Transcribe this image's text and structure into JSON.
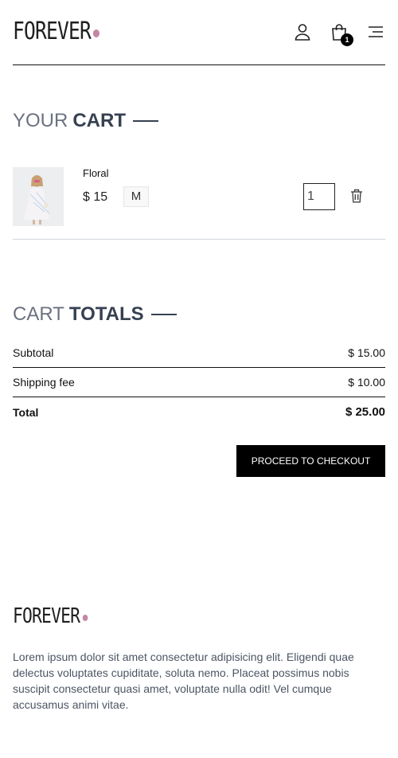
{
  "brand": {
    "logo_text": "FOREVER",
    "accent_color": "#c586a5"
  },
  "header": {
    "cart_count": "1",
    "icons": [
      "user-icon",
      "shopping-bag-icon",
      "menu-icon"
    ]
  },
  "cart": {
    "title_light": "YOUR",
    "title_bold": "CART",
    "items": [
      {
        "name": "Floral",
        "price": "$ 15",
        "size": "M",
        "quantity": "1"
      }
    ]
  },
  "totals": {
    "title_light": "CART",
    "title_bold": "TOTALS",
    "subtotal_label": "Subtotal",
    "subtotal_value": "$ 15.00",
    "shipping_label": "Shipping fee",
    "shipping_value": "$ 10.00",
    "total_label": "Total",
    "total_value": "$ 25.00",
    "checkout_label": "PROCEED TO CHECKOUT"
  },
  "footer": {
    "logo_text": "FOREVER",
    "description": "Lorem ipsum dolor sit amet consectetur adipisicing elit. Eligendi quae delectus voluptates cupiditate, soluta nemo. Placeat possimus nobis suscipit consectetur quasi amet, voluptate nulla odit! Vel cumque accusamus animi vitae."
  }
}
